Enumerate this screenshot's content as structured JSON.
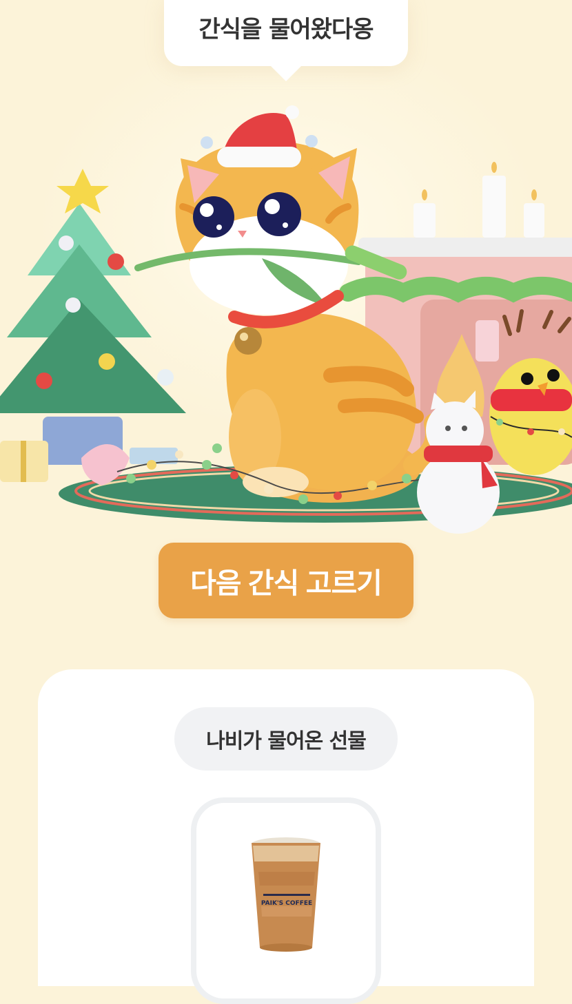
{
  "bubble": {
    "text": "간식을 물어왔다옹"
  },
  "next_button": {
    "label": "다음 간식 고르기"
  },
  "gift_card": {
    "title": "나비가 물어온 선물",
    "product": {
      "cup_text": "PAIK'S COFFEE"
    }
  },
  "colors": {
    "background": "#fcf3d9",
    "accent_button": "#e9a248",
    "pill_bg": "#f1f2f4"
  }
}
